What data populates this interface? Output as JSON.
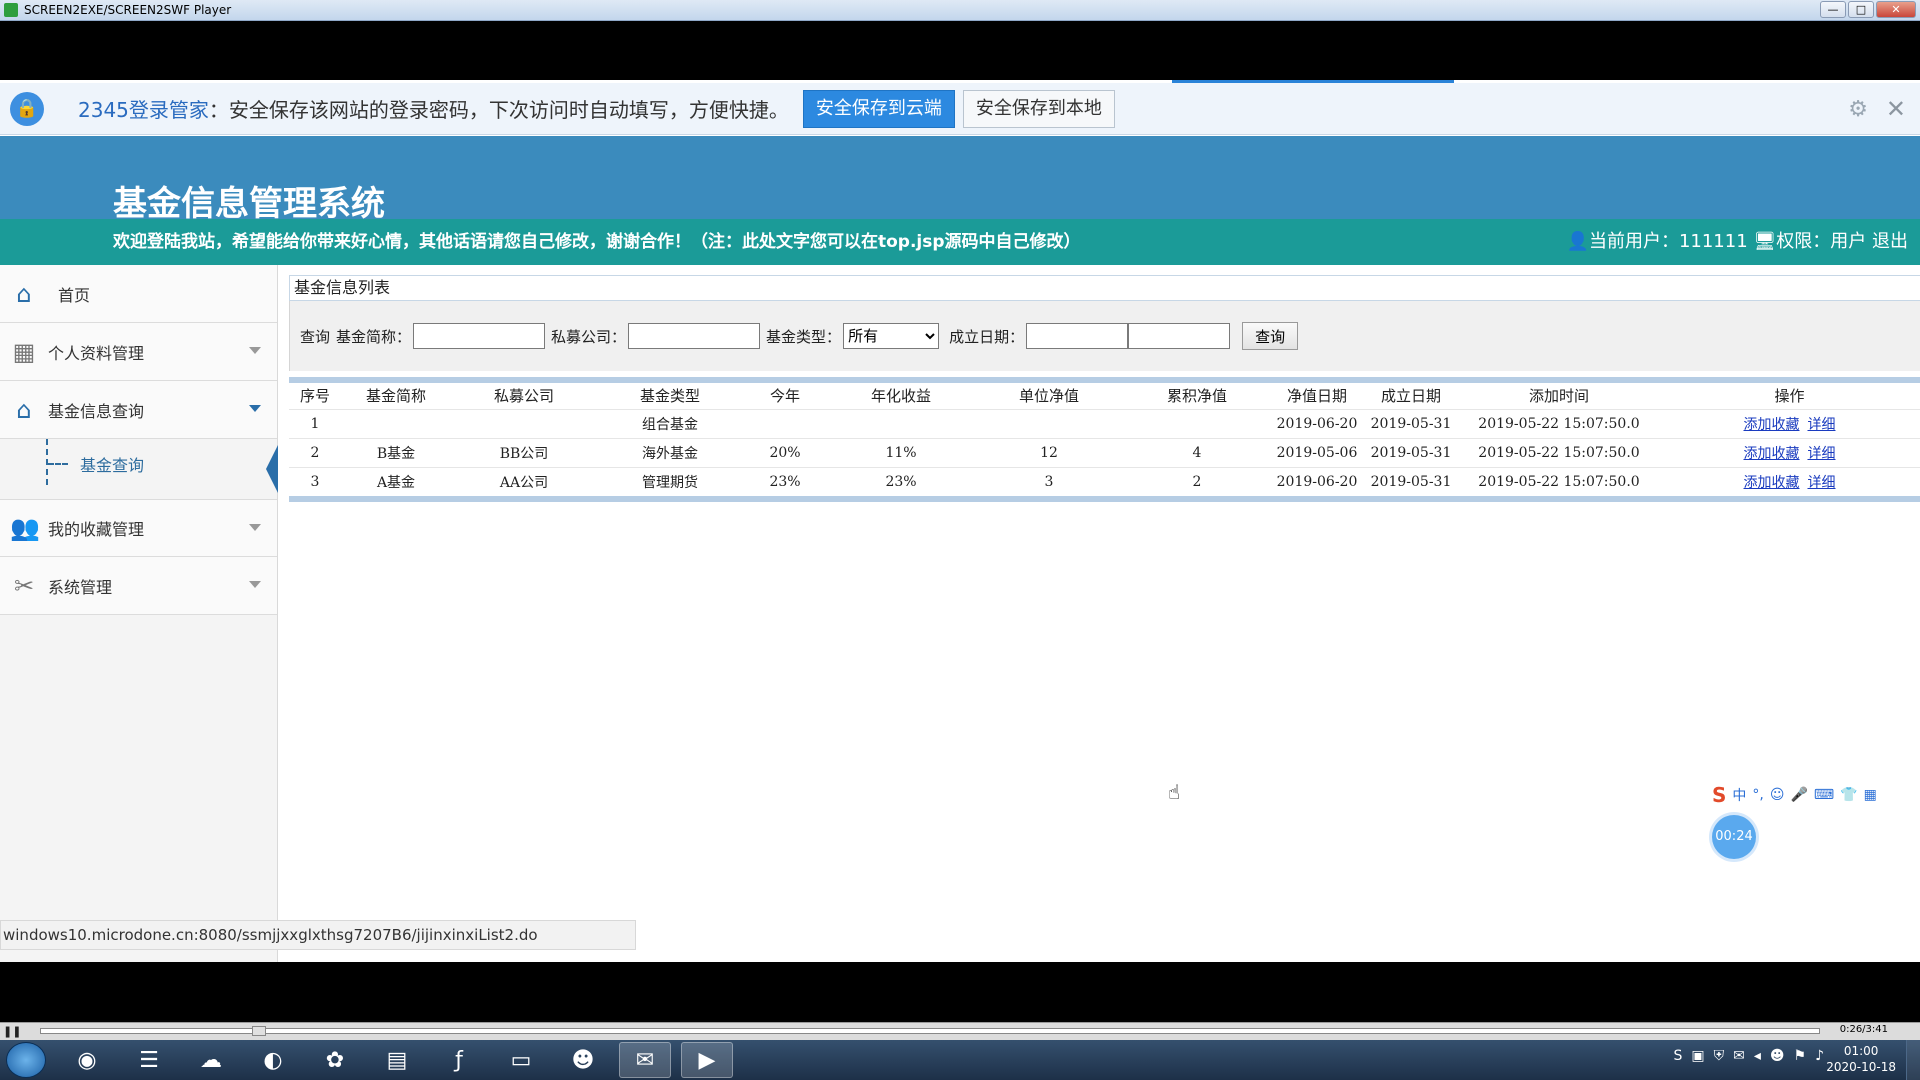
{
  "window": {
    "title": "SCREEN2EXE/SCREEN2SWF Player",
    "controls": [
      "—",
      "□",
      "✕"
    ]
  },
  "password_bar": {
    "brand": "2345登录管家",
    "message": "：安全保存该网站的登录密码，下次访问时自动填写，方便快捷。",
    "save_cloud": "安全保存到云端",
    "save_local": "安全保存到本地",
    "gear_icon": "gear-icon",
    "close_icon": "close-icon"
  },
  "header": {
    "title": "基金信息管理系统",
    "welcome": "欢迎登陆我站，希望能给你带来好心情，其他话语请您自己修改，谢谢合作！（注：此处文字您可以在top.jsp源码中自己修改）",
    "user_info": "当前用户：111111",
    "role_info": "权限：用户",
    "logout": "退出"
  },
  "sidebar": {
    "items": [
      {
        "label": "首页",
        "icon": "home-icon"
      },
      {
        "label": "个人资料管理",
        "icon": "grid-icon"
      },
      {
        "label": "基金信息查询",
        "icon": "home-icon"
      },
      {
        "label": "我的收藏管理",
        "icon": "users-icon"
      },
      {
        "label": "系统管理",
        "icon": "tools-icon"
      }
    ],
    "sub_item": "基金查询"
  },
  "content": {
    "page_title": "基金信息列表",
    "search": {
      "query_label": "查询",
      "name_label": "基金简称：",
      "company_label": "私募公司：",
      "type_label": "基金类型：",
      "type_value": "所有",
      "date_label": "成立日期：",
      "button": "查询"
    },
    "table": {
      "headers": [
        "序号",
        "基金简称",
        "私募公司",
        "基金类型",
        "今年",
        "年化收益",
        "单位净值",
        "累积净值",
        "净值日期",
        "成立日期",
        "添加时间",
        "操作"
      ],
      "rows": [
        [
          "1",
          "",
          "",
          "组合基金",
          "",
          "",
          "",
          "",
          "2019-06-20",
          "2019-05-31",
          "2019-05-22 15:07:50.0"
        ],
        [
          "2",
          "B基金",
          "BB公司",
          "海外基金",
          "20%",
          "11%",
          "12",
          "4",
          "2019-05-06",
          "2019-05-31",
          "2019-05-22 15:07:50.0"
        ],
        [
          "3",
          "A基金",
          "AA公司",
          "管理期货",
          "23%",
          "23%",
          "3",
          "2",
          "2019-06-20",
          "2019-05-31",
          "2019-05-22 15:07:50.0"
        ]
      ],
      "action_add": "添加收藏",
      "action_detail": "详细"
    }
  },
  "status_url": "windows10.microdone.cn:8080/ssmjjxxglxthsg7207B6/jijinxinxiList2.do",
  "ime": {
    "logo": "S",
    "mode": "中"
  },
  "timer": "00:24",
  "player": {
    "time": "0:26/3:41"
  },
  "taskbar": {
    "time": "01:00",
    "date": "2020-10-18"
  },
  "colors": {
    "header": "#3b8bbd",
    "welcome_bar": "#1b9b98",
    "accent": "#2c89e0"
  }
}
